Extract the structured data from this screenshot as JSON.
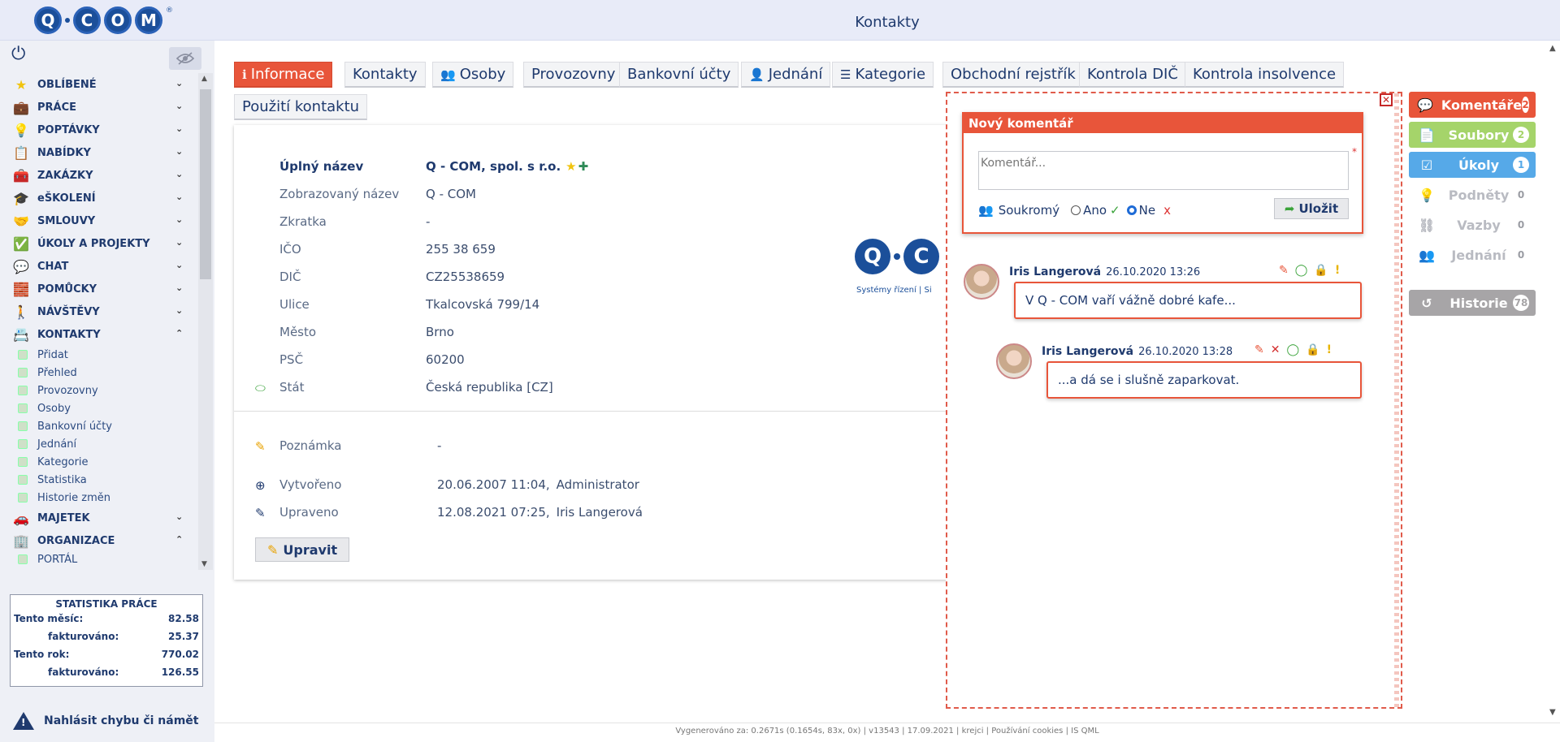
{
  "app": {
    "logo_text": [
      "Q",
      "C",
      "O",
      "M"
    ],
    "logo_reg": "®",
    "page_title": "Kontakty"
  },
  "sidebar": {
    "menu": [
      {
        "label": "OBLÍBENÉ",
        "icon": "star-icon",
        "glyph": "★",
        "color": "#f1c40f",
        "chev": "⌄"
      },
      {
        "label": "PRÁCE",
        "icon": "briefcase-icon",
        "glyph": "💼",
        "color": "#b5651d",
        "chev": "⌄"
      },
      {
        "label": "POPTÁVKY",
        "icon": "lightbulb-icon",
        "glyph": "💡",
        "color": "#8a8f9a",
        "chev": "⌄"
      },
      {
        "label": "NABÍDKY",
        "icon": "clipboard-icon",
        "glyph": "📋",
        "color": "#4a6fa5",
        "chev": "⌄"
      },
      {
        "label": "ZAKÁZKY",
        "icon": "toolbox-icon",
        "glyph": "🧰",
        "color": "#4a6fa5",
        "chev": "⌄"
      },
      {
        "label": "eŠKOLENÍ",
        "icon": "graduation-cap-icon",
        "glyph": "🎓",
        "color": "#222",
        "chev": "⌄"
      },
      {
        "label": "SMLOUVY",
        "icon": "handshake-icon",
        "glyph": "🤝",
        "color": "#4a6fa5",
        "chev": "⌄"
      },
      {
        "label": "ÚKOLY A PROJEKTY",
        "icon": "task-icon",
        "glyph": "✅",
        "color": "#1f3a6e",
        "chev": "⌄"
      },
      {
        "label": "CHAT",
        "icon": "chat-icon",
        "glyph": "💬",
        "color": "#3fa9f5",
        "chev": "⌄"
      },
      {
        "label": "POMŮCKY",
        "icon": "tools-icon",
        "glyph": "🧱",
        "color": "#d9a441",
        "chev": "⌄"
      },
      {
        "label": "NÁVŠTĚVY",
        "icon": "walking-person-icon",
        "glyph": "🚶",
        "color": "#1f3a6e",
        "chev": "⌄"
      },
      {
        "label": "KONTAKTY",
        "icon": "contacts-icon",
        "glyph": "📇",
        "color": "#4a8f4a",
        "chev": "⌃"
      }
    ],
    "submenu": [
      "Přidat",
      "Přehled",
      "Provozovny",
      "Osoby",
      "Bankovní účty",
      "Jednání",
      "Kategorie",
      "Statistika",
      "Historie změn"
    ],
    "menu_after": [
      {
        "label": "MAJETEK",
        "icon": "car-icon",
        "glyph": "🚗",
        "color": "#c62828",
        "chev": "⌄"
      },
      {
        "label": "ORGANIZACE",
        "icon": "organization-icon",
        "glyph": "🏢",
        "color": "#4a8f4a",
        "chev": "⌃"
      }
    ],
    "portal": "PORTÁL",
    "stats": {
      "title": "STATISTIKA PRÁCE",
      "month_label": "Tento měsíc:",
      "month_value": "82.58",
      "month_inv_label": "fakturováno:",
      "month_inv_value": "25.37",
      "year_label": "Tento rok:",
      "year_value": "770.02",
      "year_inv_label": "fakturováno:",
      "year_inv_value": "126.55"
    },
    "report_label": "Nahlásit chybu či námět"
  },
  "tabs": [
    {
      "label": "Informace",
      "icon": "info-icon",
      "glyph": "ℹ",
      "active": true
    },
    {
      "label": "Kontakty",
      "icon": "",
      "glyph": "",
      "active": false
    },
    {
      "label": "Osoby",
      "icon": "users-icon",
      "glyph": "👥",
      "active": false
    },
    {
      "label": "Provozovny",
      "icon": "",
      "glyph": "",
      "active": false
    },
    {
      "label": "Bankovní účty",
      "icon": "",
      "glyph": "",
      "active": false
    },
    {
      "label": "Jednání",
      "icon": "meeting-icon",
      "glyph": "👤",
      "active": false
    },
    {
      "label": "Kategorie",
      "icon": "list-icon",
      "glyph": "☰",
      "active": false
    },
    {
      "label": "Obchodní rejstřík",
      "icon": "",
      "glyph": "",
      "active": false
    },
    {
      "label": "Kontrola DIČ",
      "icon": "",
      "glyph": "",
      "active": false
    },
    {
      "label": "Kontrola insolvence",
      "icon": "",
      "glyph": "",
      "active": false
    },
    {
      "label": "Použití kontaktu",
      "icon": "",
      "glyph": "",
      "active": false
    }
  ],
  "info": {
    "fields": [
      {
        "label": "Úplný název",
        "value": "Q - COM, spol. s r.o.",
        "bold": true
      },
      {
        "label": "Zobrazovaný název",
        "value": "Q - COM"
      },
      {
        "label": "Zkratka",
        "value": "-"
      },
      {
        "label": "IČO",
        "value": "255 38 659"
      },
      {
        "label": "DIČ",
        "value": "CZ25538659"
      },
      {
        "label": "Ulice",
        "value": "Tkalcovská 799/14"
      },
      {
        "label": "Město",
        "value": "Brno"
      },
      {
        "label": "PSČ",
        "value": "60200"
      },
      {
        "label": "Stát",
        "value": "Česká republika [CZ]"
      }
    ],
    "note_label": "Poznámka",
    "note_value": "-",
    "created_label": "Vytvořeno",
    "created_value": "20.06.2007 11:04,",
    "created_by": "Administrator",
    "updated_label": "Upraveno",
    "updated_value": "12.08.2021 07:25,",
    "updated_by": "Iris Langerová",
    "edit_label": "Upravit",
    "company_logo_text": [
      "Q",
      "C"
    ],
    "company_logo_sub": "Systémy řízení  |  Si"
  },
  "comments": {
    "new_title": "Nový komentář",
    "placeholder": "Komentář...",
    "required_mark": "*",
    "private_label": "Soukromý",
    "yes_label": "Ano",
    "no_label": "Ne",
    "save_label": "Uložit",
    "items": [
      {
        "author": "Iris Langerová",
        "date": "26.10.2020 13:26",
        "text": "V Q - COM vaří vážně dobré kafe..."
      },
      {
        "author": "Iris Langerová",
        "date": "26.10.2020 13:28",
        "text": "...a dá se i slušně zaparkovat."
      }
    ]
  },
  "right_panel": [
    {
      "label": "Komentáře",
      "badge": "2",
      "color": "#e8553a",
      "icon": "comment-icon",
      "glyph": "💬"
    },
    {
      "label": "Soubory",
      "badge": "2",
      "color": "#a5d46a",
      "icon": "file-icon",
      "glyph": "📄"
    },
    {
      "label": "Úkoly",
      "badge": "1",
      "color": "#56a9e8",
      "icon": "task-icon",
      "glyph": "☑"
    },
    {
      "label": "Podněty",
      "badge": "0",
      "color": "transparent",
      "icon": "lightbulb-icon",
      "glyph": "💡"
    },
    {
      "label": "Vazby",
      "badge": "0",
      "color": "transparent",
      "icon": "links-icon",
      "glyph": "⛓"
    },
    {
      "label": "Jednání",
      "badge": "0",
      "color": "transparent",
      "icon": "users-icon",
      "glyph": "👥"
    },
    {
      "label": "Historie",
      "badge": "78",
      "color": "#a7a5a7",
      "icon": "history-icon",
      "glyph": "↺"
    }
  ],
  "footer": "Vygenerováno za: 0.2671s (0.1654s, 83x, 0x) | v13543 | 17.09.2021 | krejci | Používání cookies | IS QML"
}
